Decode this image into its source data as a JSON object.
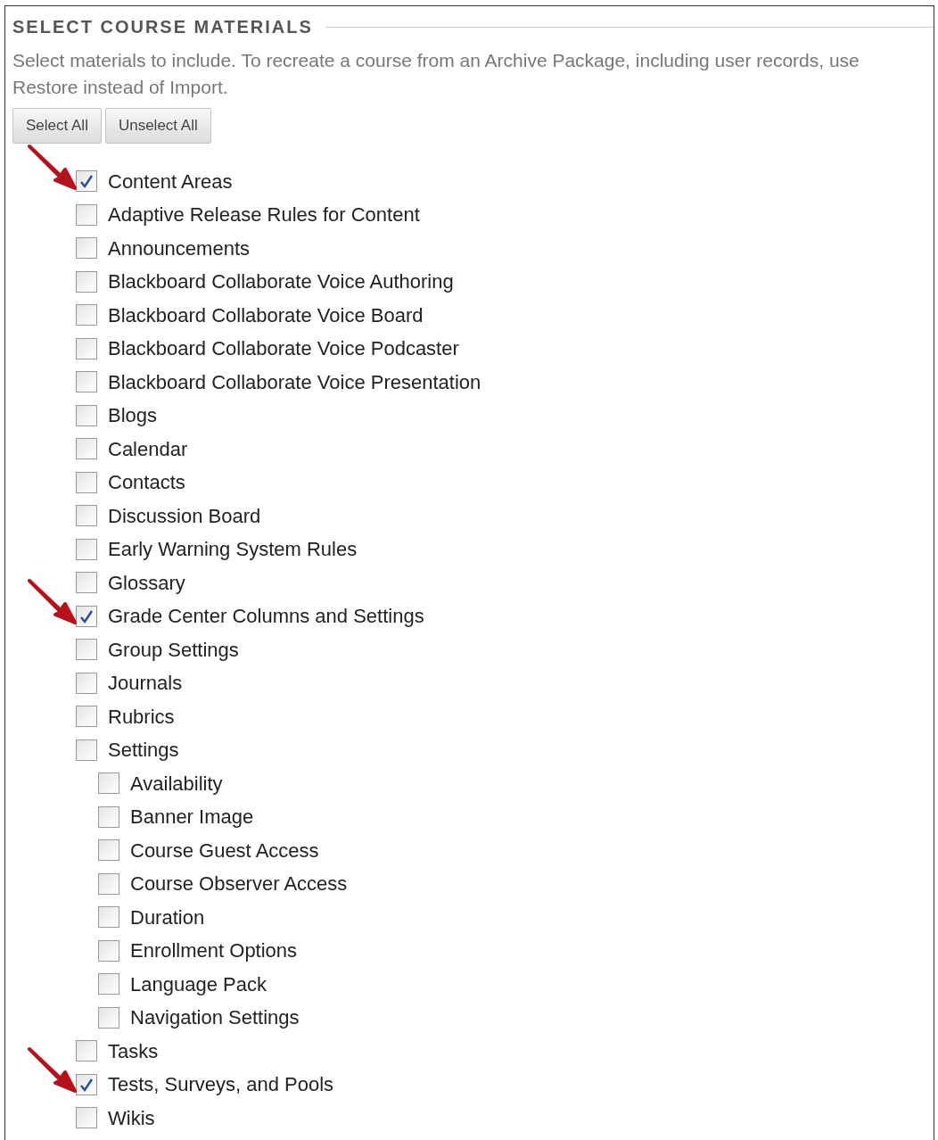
{
  "section_title": "SELECT COURSE MATERIALS",
  "description": "Select materials to include. To recreate a course from an Archive Package, including user records, use Restore instead of Import.",
  "buttons": [
    "Select All",
    "Unselect All"
  ],
  "materials": [
    {
      "label": "Content Areas",
      "checked": true,
      "arrow": true
    },
    {
      "label": "Adaptive Release Rules for Content",
      "checked": false,
      "arrow": false
    },
    {
      "label": "Announcements",
      "checked": false,
      "arrow": false
    },
    {
      "label": "Blackboard Collaborate Voice Authoring",
      "checked": false,
      "arrow": false
    },
    {
      "label": "Blackboard Collaborate Voice Board",
      "checked": false,
      "arrow": false
    },
    {
      "label": "Blackboard Collaborate Voice Podcaster",
      "checked": false,
      "arrow": false
    },
    {
      "label": "Blackboard Collaborate Voice Presentation",
      "checked": false,
      "arrow": false
    },
    {
      "label": "Blogs",
      "checked": false,
      "arrow": false
    },
    {
      "label": "Calendar",
      "checked": false,
      "arrow": false
    },
    {
      "label": "Contacts",
      "checked": false,
      "arrow": false
    },
    {
      "label": "Discussion Board",
      "checked": false,
      "arrow": false
    },
    {
      "label": "Early Warning System Rules",
      "checked": false,
      "arrow": false
    },
    {
      "label": "Glossary",
      "checked": false,
      "arrow": false
    },
    {
      "label": "Grade Center Columns and Settings",
      "checked": true,
      "arrow": true
    },
    {
      "label": "Group Settings",
      "checked": false,
      "arrow": false
    },
    {
      "label": "Journals",
      "checked": false,
      "arrow": false
    },
    {
      "label": "Rubrics",
      "checked": false,
      "arrow": false
    },
    {
      "label": "Settings",
      "checked": false,
      "arrow": false,
      "children": [
        {
          "label": "Availability",
          "checked": false,
          "arrow": false
        },
        {
          "label": "Banner Image",
          "checked": false,
          "arrow": false
        },
        {
          "label": "Course Guest Access",
          "checked": false,
          "arrow": false
        },
        {
          "label": "Course Observer Access",
          "checked": false,
          "arrow": false
        },
        {
          "label": "Duration",
          "checked": false,
          "arrow": false
        },
        {
          "label": "Enrollment Options",
          "checked": false,
          "arrow": false
        },
        {
          "label": "Language Pack",
          "checked": false,
          "arrow": false
        },
        {
          "label": "Navigation Settings",
          "checked": false,
          "arrow": false
        }
      ]
    },
    {
      "label": "Tasks",
      "checked": false,
      "arrow": false
    },
    {
      "label": "Tests, Surveys, and Pools",
      "checked": true,
      "arrow": true
    },
    {
      "label": "Wikis",
      "checked": false,
      "arrow": false
    }
  ]
}
